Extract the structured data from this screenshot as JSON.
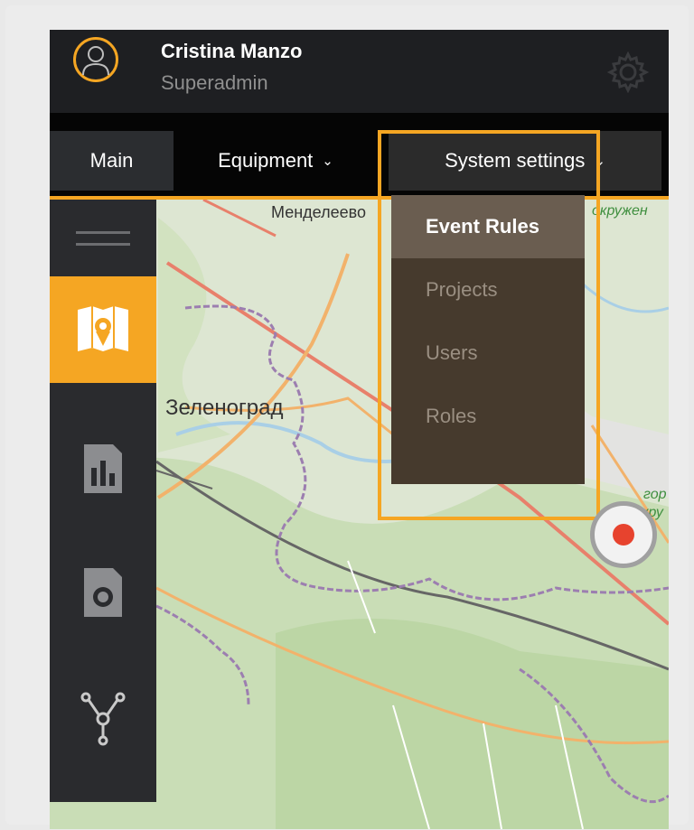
{
  "user": {
    "name": "Cristina Manzo",
    "role": "Superadmin"
  },
  "nav": {
    "tabs": [
      {
        "label": "Main"
      },
      {
        "label": "Equipment"
      },
      {
        "label": "System settings"
      }
    ]
  },
  "dropdown": {
    "items": [
      {
        "label": "Event Rules",
        "active": true
      },
      {
        "label": "Projects"
      },
      {
        "label": "Users"
      },
      {
        "label": "Roles"
      }
    ]
  },
  "map": {
    "labels": {
      "zelenograd": "Зеленоград",
      "mendeleevo": "Менделеево",
      "okruzh": "окружен",
      "gor": "гор",
      "kru": "кру"
    }
  },
  "sidebar": {
    "items": [
      "menu-icon",
      "map-icon",
      "stats-icon",
      "camera-icon",
      "network-icon"
    ]
  },
  "colors": {
    "accent": "#f5a623",
    "dropdown_bg": "#463a2d",
    "record": "#e7432e"
  }
}
